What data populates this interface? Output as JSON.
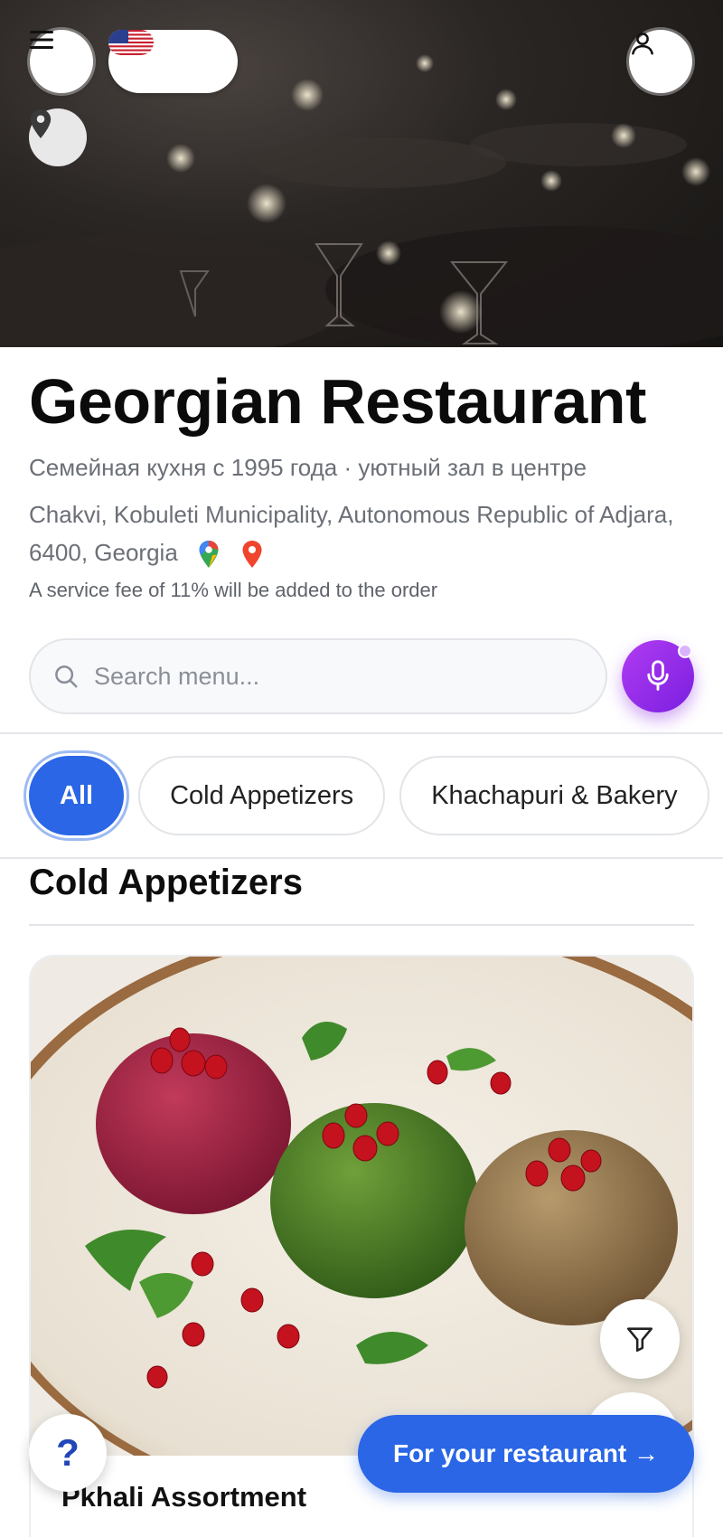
{
  "header": {
    "menu_icon": "hamburger-menu-icon",
    "translate_icon": "translate-icon",
    "flag": "us-flag",
    "location_icon": "map-pin-icon",
    "user_icon": "user-profile-icon"
  },
  "restaurant": {
    "name": "Georgian Restaurant",
    "tagline": "Семейная кухня с 1995 года · уютный зал в центре",
    "address": "Chakvi, Kobuleti Municipality, Autonomous Republic of Adjara, 6400, Georgia",
    "fee_note": "A service fee of 11% will be added to the order"
  },
  "search": {
    "placeholder": "Search menu...",
    "value": ""
  },
  "categories": [
    {
      "label": "All",
      "active": true
    },
    {
      "label": "Cold Appetizers",
      "active": false
    },
    {
      "label": "Khachapuri & Bakery",
      "active": false
    }
  ],
  "sections": [
    {
      "title": "Cold Appetizers",
      "items": [
        {
          "name": "Pkhali Assortment"
        }
      ]
    }
  ],
  "floating": {
    "help_label": "?",
    "cta_label": "For your restaurant →"
  },
  "colors": {
    "primary": "#2a66e6",
    "mic_gradient_start": "#b13cf2",
    "mic_gradient_end": "#7a1fe0",
    "text_muted": "#6b6f76"
  }
}
